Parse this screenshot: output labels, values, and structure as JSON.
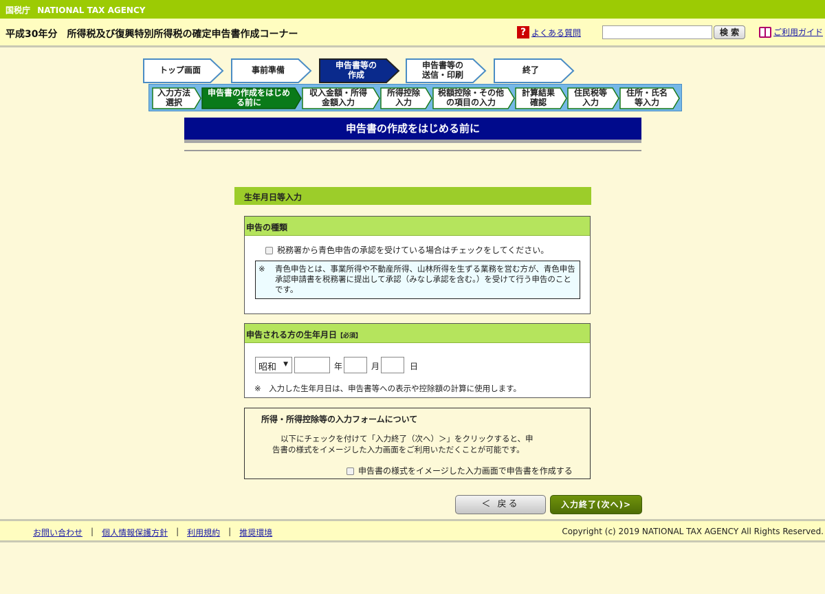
{
  "agency": {
    "kanji": "国税庁",
    "name": "NATIONAL TAX AGENCY"
  },
  "header": {
    "title": "平成30年分　所得税及び復興特別所得税の確定申告書作成コーナー",
    "faq_label": "よくある質問",
    "search_value": "",
    "search_button": "検 索",
    "guide_label": "ご利用ガイド"
  },
  "steps": [
    {
      "label": "トップ画面"
    },
    {
      "label": "事前準備"
    },
    {
      "label": "申告書等の\n作成"
    },
    {
      "label": "申告書等の\n送信・印刷"
    },
    {
      "label": "終了"
    }
  ],
  "substeps": [
    {
      "label": "入力方法\n選択"
    },
    {
      "label": "申告書の作成をはじめ\nる前に"
    },
    {
      "label": "収入金額・所得\n金額入力"
    },
    {
      "label": "所得控除\n入力"
    },
    {
      "label": "税額控除・その他\nの項目の入力"
    },
    {
      "label": "計算結果\n確認"
    },
    {
      "label": "住民税等\n入力"
    },
    {
      "label": "住所・氏名\n等入力"
    }
  ],
  "section_title": "申告書の作成をはじめる前に",
  "form": {
    "header": "生年月日等入力",
    "filing_type": {
      "title": "申告の種類",
      "checkbox_label": "税務署から青色申告の承認を受けている場合はチェックをしてください。",
      "note_mark": "※",
      "note_text": "青色申告とは、事業所得や不動産所得、山林所得を生ずる業務を営む方が、青色申告承認申請書を税務署に提出して承認（みなし承認を含む。）を受けて行う申告のことです。"
    },
    "birthdate": {
      "title": "申告される方の生年月日",
      "required": "【必須】",
      "era_value": "昭和",
      "year_unit": "年",
      "month_unit": "月",
      "day_unit": "日",
      "note": "※　入力した生年月日は、申告書等への表示や控除額の計算に使用します。"
    },
    "input_form": {
      "title": "所得・所得控除等の入力フォームについて",
      "description_line1": "以下にチェックを付けて「入力終了（次へ）＞」をクリックすると、申",
      "description_line2": "告書の様式をイメージした入力画面をご利用いただくことが可能です。",
      "checkbox_label": "申告書の様式をイメージした入力画面で申告書を作成する"
    }
  },
  "buttons": {
    "back": "＜ 戻る",
    "next": "入力終了(次へ)>"
  },
  "footer": {
    "links": [
      "お問い合わせ",
      "個人情報保護方針",
      "利用規約",
      "推奨環境"
    ],
    "copyright": "Copyright (c) 2019 NATIONAL TAX AGENCY All Rights Reserved."
  },
  "colors": {
    "agency_bar": "#9ccb04",
    "header_bg": "#fffdc0",
    "page_bg": "#fdf9d8",
    "step_active": "#0a2a8c",
    "substep_active": "#0a7a1a",
    "section_title_bg": "#000a8c",
    "form_header": "#9ccd2a",
    "box_head": "#b5e45d",
    "next_button": "#5a7a08"
  }
}
